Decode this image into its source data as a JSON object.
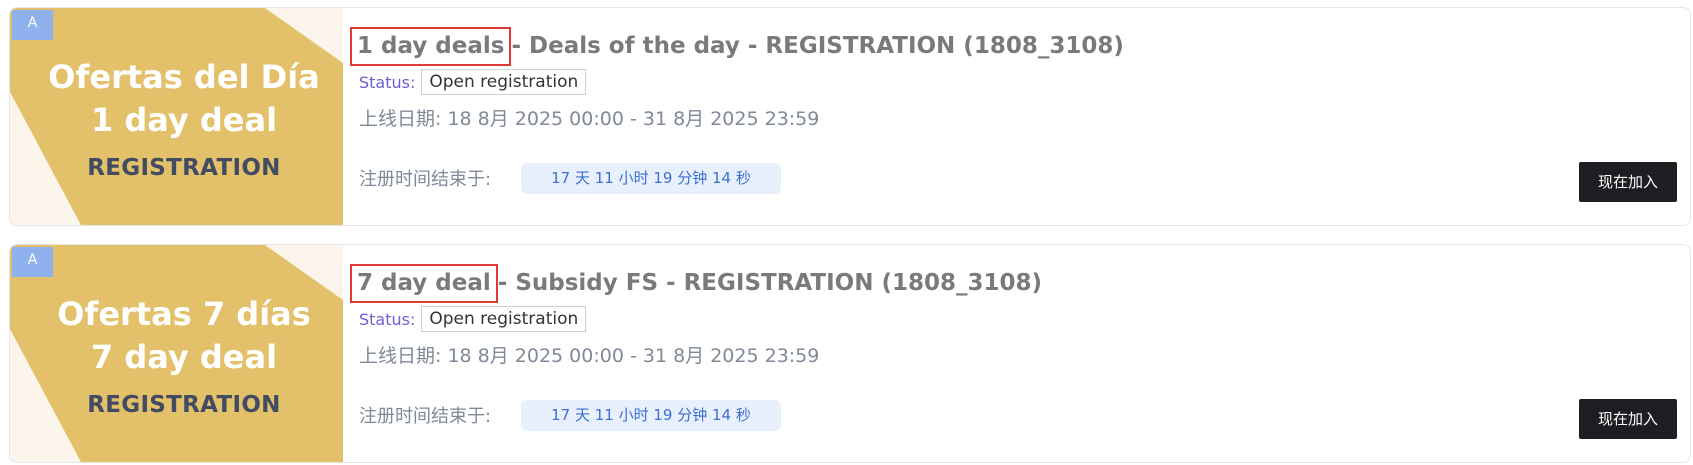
{
  "deals": [
    {
      "badge": "A",
      "banner": {
        "line1": "Ofertas del Día",
        "line2": "1 day deal",
        "line3": "REGISTRATION"
      },
      "title_highlight": "1 day deals",
      "title_rest": "- Deals of the day - REGISTRATION (1808_3108)",
      "status_label": "Status:",
      "status_value": "Open registration",
      "dates": "上线日期: 18 8月 2025 00:00 - 31 8月 2025 23:59",
      "registration_label": "注册时间结束于:",
      "countdown": "17 天 11 小时 19 分钟 14 秒",
      "join_label": "现在加入"
    },
    {
      "badge": "A",
      "banner": {
        "line1": "Ofertas 7 días",
        "line2": "7 day deal",
        "line3": "REGISTRATION"
      },
      "title_highlight": "7 day deal",
      "title_rest": "- Subsidy FS - REGISTRATION (1808_3108)",
      "status_label": "Status:",
      "status_value": "Open registration",
      "dates": "上线日期: 18 8月 2025 00:00 - 31 8月 2025 23:59",
      "registration_label": "注册时间结束于:",
      "countdown": "17 天 11 小时 19 分钟 14 秒",
      "join_label": "现在加入"
    }
  ],
  "colors": {
    "banner_gold": "#e3c06a",
    "banner_bg": "#fbf5ec",
    "badge_blue": "#8fb1ee",
    "highlight_red": "#e03a35",
    "status_purple": "#6a5fd2",
    "countdown_bg": "#e8f0fd",
    "countdown_text": "#3d6fd1",
    "button_dark": "#1e1e22"
  }
}
